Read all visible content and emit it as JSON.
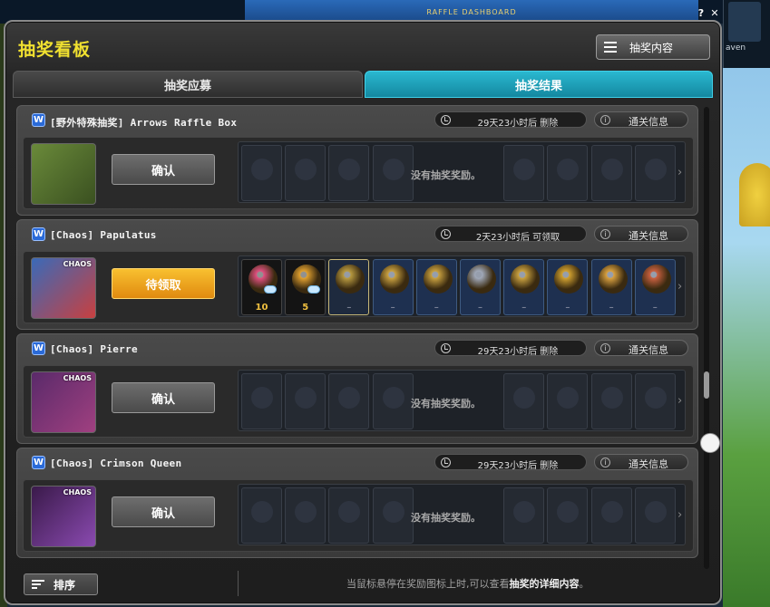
{
  "window": {
    "top_label": "RAFFLE DASHBOARD",
    "title": "抽奖看板",
    "content_button": "抽奖内容",
    "help_glyph": "?",
    "close_glyph": "✕"
  },
  "tabs": [
    {
      "label": "抽奖应募",
      "active": false
    },
    {
      "label": "抽奖结果",
      "active": true
    }
  ],
  "background": {
    "player_name": "aven"
  },
  "raffles": [
    {
      "name": "[野外特殊抽奖] Arrows Raffle Box",
      "timer": "29天23小时后 删除",
      "info_label": "通关信息",
      "action_label": "确认",
      "action_state": "confirm",
      "chaos_tag": "",
      "no_reward_text": "没有抽奖奖励。",
      "rewards": []
    },
    {
      "name": "[Chaos] Papulatus",
      "timer": "2天23小时后 可领取",
      "info_label": "通关信息",
      "action_label": "待领取",
      "action_state": "pending",
      "chaos_tag": "CHAOS",
      "no_reward_text": "",
      "rewards": [
        {
          "icon": "pink-coin-icon",
          "count": "10",
          "color": "#e05080"
        },
        {
          "icon": "orange-coin-icon",
          "count": "5",
          "color": "#e0a030"
        },
        {
          "icon": "gold-coin-icon",
          "count": "–",
          "color": "#b89a40"
        },
        {
          "icon": "gold-coin-icon",
          "count": "–",
          "color": "#c8a040"
        },
        {
          "icon": "gold-coin-icon",
          "count": "–",
          "color": "#c8a040"
        },
        {
          "icon": "scroll-icon",
          "count": "–",
          "color": "#a0a8b8"
        },
        {
          "icon": "coin-pile-icon",
          "count": "–",
          "color": "#c8a040"
        },
        {
          "icon": "bowl-icon",
          "count": "–",
          "color": "#d0a030"
        },
        {
          "icon": "coins-stack-icon",
          "count": "–",
          "color": "#d8a040"
        },
        {
          "icon": "ornament-icon",
          "count": "–",
          "color": "#c86040"
        }
      ]
    },
    {
      "name": "[Chaos] Pierre",
      "timer": "29天23小时后 删除",
      "info_label": "通关信息",
      "action_label": "确认",
      "action_state": "confirm",
      "chaos_tag": "CHAOS",
      "no_reward_text": "没有抽奖奖励。",
      "rewards": []
    },
    {
      "name": "[Chaos] Crimson Queen",
      "timer": "29天23小时后 删除",
      "info_label": "通关信息",
      "action_label": "确认",
      "action_state": "confirm",
      "chaos_tag": "CHAOS",
      "no_reward_text": "没有抽奖奖励。",
      "rewards": []
    }
  ],
  "footer": {
    "sort_label": "排序",
    "hint_prefix": "当鼠标悬停在奖励图标上时,可以查看",
    "hint_bold": "抽奖的详细内容",
    "hint_suffix": "。"
  },
  "colors": {
    "title": "#f0e030",
    "tab_active": "#1fa0b8",
    "pending_button": "#f0a020",
    "count_text": "#f0c040"
  }
}
